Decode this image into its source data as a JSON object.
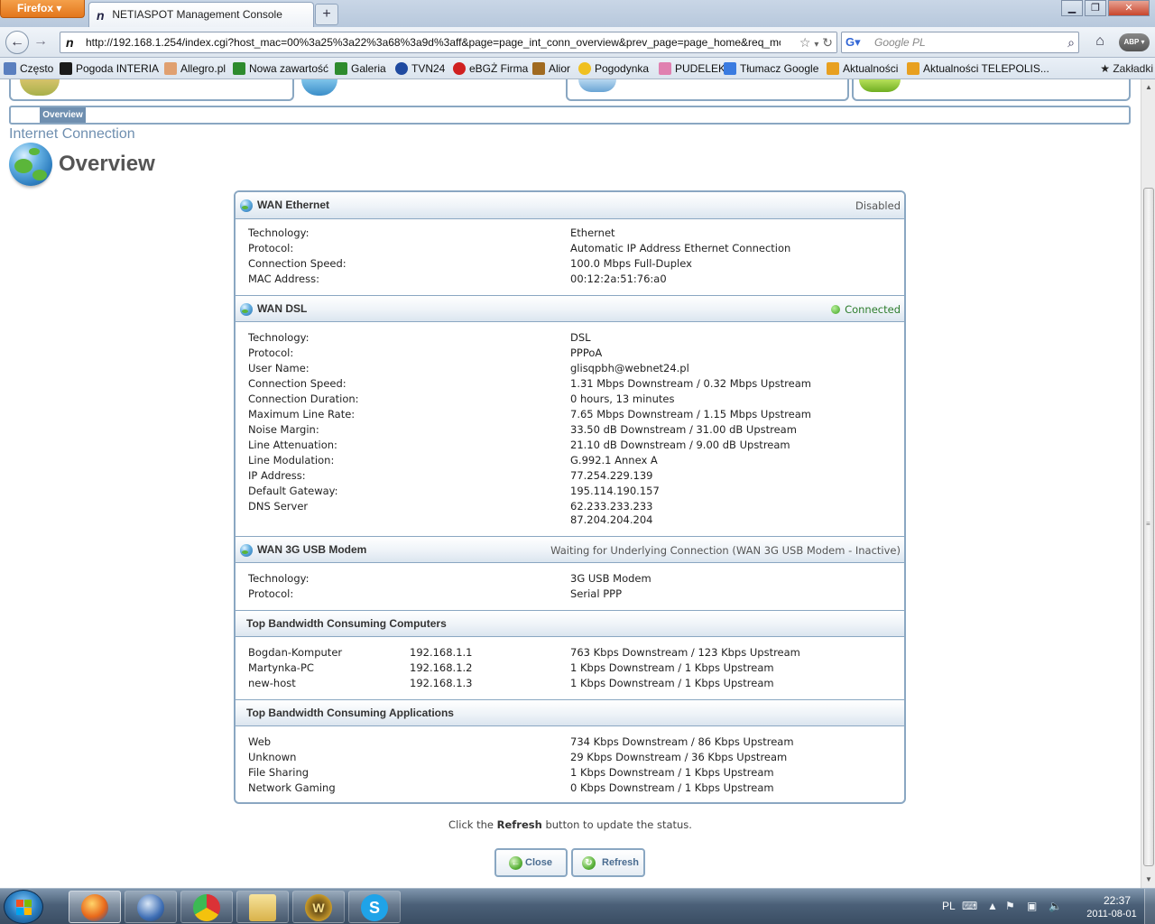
{
  "browser": {
    "app_button": "Firefox",
    "tab_title": "NETIASPOT Management Console",
    "new_tab": "+",
    "url": "http://192.168.1.254/index.cgi?host_mac=00%3a25%3a22%3a68%3a9d%3aff&page=page_int_conn_overview&prev_page=page_home&req_mode=",
    "search_placeholder": "Google PL",
    "bookmarks": [
      "Często",
      "Pogoda INTERIA",
      "Allegro.pl",
      "Nowa zawartość",
      "Galeria",
      "TVN24",
      "eBGŻ Firma",
      "Alior",
      "Pogodynka",
      "PUDELEK",
      "Tłumacz Google",
      "Aktualności",
      "Aktualności TELEPOLIS..."
    ],
    "bookmarks_menu": "Zakładki"
  },
  "page": {
    "subnav_tab": "Overview",
    "section_title": "Internet Connection",
    "heading": "Overview",
    "wan_ethernet": {
      "title": "WAN Ethernet",
      "status": "Disabled",
      "rows": [
        {
          "k": "Technology:",
          "v": "Ethernet"
        },
        {
          "k": "Protocol:",
          "v": "Automatic IP Address Ethernet Connection"
        },
        {
          "k": "Connection Speed:",
          "v": "100.0 Mbps Full-Duplex"
        },
        {
          "k": "MAC Address:",
          "v": "00:12:2a:51:76:a0"
        }
      ]
    },
    "wan_dsl": {
      "title": "WAN DSL",
      "status": "Connected",
      "rows": [
        {
          "k": "Technology:",
          "v": "DSL"
        },
        {
          "k": "Protocol:",
          "v": "PPPoA"
        },
        {
          "k": "User Name:",
          "v": "glisqpbh@webnet24.pl"
        },
        {
          "k": "Connection Speed:",
          "v": "1.31 Mbps Downstream / 0.32 Mbps Upstream"
        },
        {
          "k": "Connection Duration:",
          "v": "0 hours, 13 minutes"
        },
        {
          "k": "Maximum Line Rate:",
          "v": "7.65 Mbps Downstream / 1.15 Mbps Upstream"
        },
        {
          "k": "Noise Margin:",
          "v": "33.50 dB Downstream / 31.00 dB Upstream"
        },
        {
          "k": "Line Attenuation:",
          "v": "21.10 dB Downstream / 9.00 dB Upstream"
        },
        {
          "k": "Line Modulation:",
          "v": "G.992.1 Annex A"
        },
        {
          "k": "IP Address:",
          "v": "77.254.229.139"
        },
        {
          "k": "Default Gateway:",
          "v": "195.114.190.157"
        },
        {
          "k": "DNS Server",
          "v": "62.233.233.233"
        },
        {
          "k": "",
          "v": "87.204.204.204"
        }
      ]
    },
    "wan_3g": {
      "title": "WAN 3G USB Modem",
      "status": "Waiting for Underlying Connection (WAN 3G USB Modem - Inactive)",
      "rows": [
        {
          "k": "Technology:",
          "v": "3G USB Modem"
        },
        {
          "k": "Protocol:",
          "v": "Serial PPP"
        }
      ]
    },
    "top_computers": {
      "title": "Top Bandwidth Consuming Computers",
      "rows": [
        {
          "k": "Bogdan-Komputer",
          "m": "192.168.1.1",
          "v": "763 Kbps Downstream / 123 Kbps Upstream"
        },
        {
          "k": "Martynka-PC",
          "m": "192.168.1.2",
          "v": "1 Kbps Downstream / 1 Kbps Upstream"
        },
        {
          "k": "new-host",
          "m": "192.168.1.3",
          "v": "1 Kbps Downstream / 1 Kbps Upstream"
        }
      ]
    },
    "top_apps": {
      "title": "Top Bandwidth Consuming Applications",
      "rows": [
        {
          "k": "Web",
          "v": "734 Kbps Downstream / 86 Kbps Upstream"
        },
        {
          "k": "Unknown",
          "v": "29 Kbps Downstream / 36 Kbps Upstream"
        },
        {
          "k": "File Sharing",
          "v": "1 Kbps Downstream / 1 Kbps Upstream"
        },
        {
          "k": "Network Gaming",
          "v": "0 Kbps Downstream / 1 Kbps Upstream"
        }
      ]
    },
    "hint_prefix": "Click the",
    "hint_bold": "Refresh",
    "hint_suffix": "button to update the status.",
    "close_label": "Close",
    "refresh_label": "Refresh"
  },
  "taskbar": {
    "apps": [
      "firefox",
      "thunderbird",
      "chrome",
      "explorer",
      "world-of-warcraft",
      "skype"
    ],
    "lang": "PL",
    "time": "22:37",
    "date": "2011-08-01"
  }
}
